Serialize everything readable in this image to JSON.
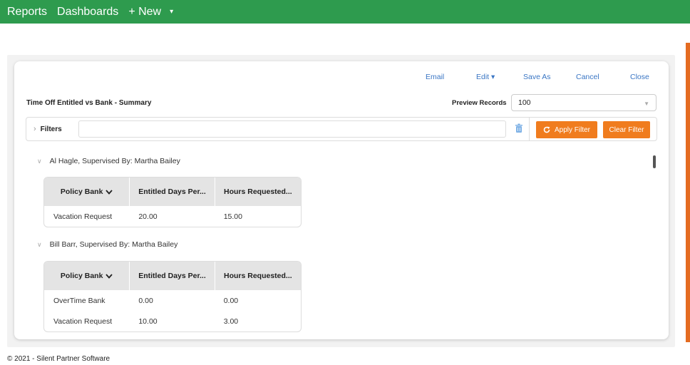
{
  "topnav": {
    "reports": "Reports",
    "dashboards": "Dashboards",
    "new": "+ New",
    "new_caret": "▾"
  },
  "actions": {
    "email": "Email",
    "edit": "Edit ▾",
    "save_as": "Save As",
    "cancel": "Cancel",
    "close": "Close"
  },
  "report": {
    "title": "Time Off Entitled vs Bank - Summary",
    "preview_label": "Preview Records",
    "preview_value": "100"
  },
  "filters": {
    "toggle_label": "Filters",
    "input_value": "",
    "apply_label": "Apply Filter",
    "clear_label": "Clear Filter"
  },
  "columns": {
    "policy_bank": "Policy Bank",
    "entitled_days": "Entitled Days Per...",
    "hours_requested": "Hours Requested..."
  },
  "groups": [
    {
      "header": "Al Hagle, Supervised By: Martha Bailey",
      "rows": [
        {
          "policy": "Vacation Request",
          "entitled": "20.00",
          "hours": "15.00"
        }
      ]
    },
    {
      "header": "Bill Barr, Supervised By: Martha Bailey",
      "rows": [
        {
          "policy": "OverTime Bank",
          "entitled": "0.00",
          "hours": "0.00"
        },
        {
          "policy": "Vacation Request",
          "entitled": "10.00",
          "hours": "3.00"
        }
      ]
    }
  ],
  "footer": "© 2021 - Silent Partner Software",
  "colors": {
    "topbar": "#2e9b4e",
    "accent_orange": "#f07c1e",
    "link_blue": "#3a76c4"
  }
}
